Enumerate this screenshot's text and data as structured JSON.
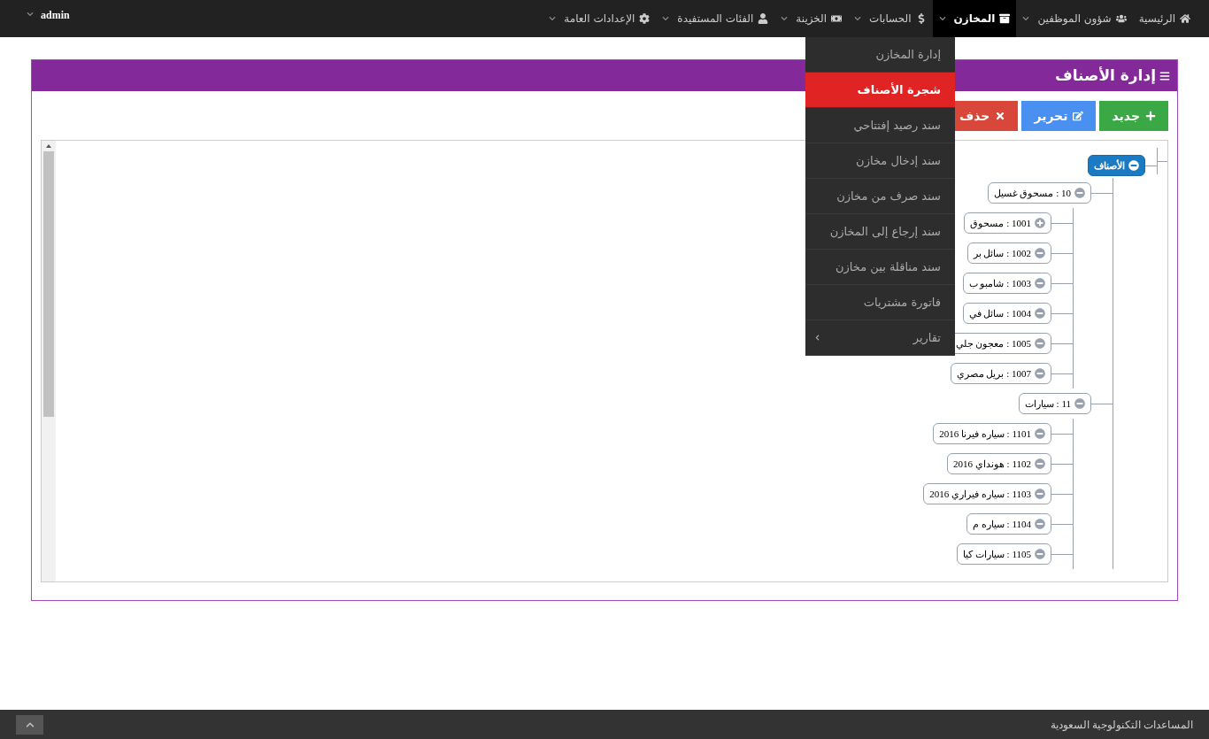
{
  "navbar": {
    "items": [
      {
        "label": "الرئيسية",
        "has_dropdown": false,
        "selected": false
      },
      {
        "label": "شؤون الموظفين",
        "has_dropdown": true,
        "selected": false
      },
      {
        "label": "المخازن",
        "has_dropdown": true,
        "selected": true
      },
      {
        "label": "الحسابات",
        "has_dropdown": true,
        "selected": false
      },
      {
        "label": "الخزينة",
        "has_dropdown": true,
        "selected": false
      },
      {
        "label": "الفئات المستفيدة",
        "has_dropdown": true,
        "selected": false
      },
      {
        "label": "الإعدادات العامة",
        "has_dropdown": true,
        "selected": false
      }
    ],
    "user": "admin"
  },
  "dropdown": {
    "items": [
      {
        "label": "إدارة المخازن",
        "selected": false,
        "has_submenu": false
      },
      {
        "label": "شجرة الأصناف",
        "selected": true,
        "has_submenu": false
      },
      {
        "label": "سند رصيد إفتتاحي",
        "selected": false,
        "has_submenu": false
      },
      {
        "label": "سند إدخال مخازن",
        "selected": false,
        "has_submenu": false
      },
      {
        "label": "سند صرف من مخازن",
        "selected": false,
        "has_submenu": false
      },
      {
        "label": "سند إرجاع إلى المخازن",
        "selected": false,
        "has_submenu": false
      },
      {
        "label": "سند مناقلة بين مخازن",
        "selected": false,
        "has_submenu": false
      },
      {
        "label": "فاتورة مشتريات",
        "selected": false,
        "has_submenu": false
      },
      {
        "label": "تقارير",
        "selected": false,
        "has_submenu": true
      }
    ]
  },
  "panel": {
    "title": "إدارة الأصناف",
    "buttons": [
      {
        "kind": "new",
        "label": "جديد"
      },
      {
        "kind": "edit",
        "label": "تحرير"
      },
      {
        "kind": "delete",
        "label": "حذف"
      }
    ],
    "tree": {
      "label": "الأصناف",
      "selected": true,
      "expanded": true,
      "children": [
        {
          "label": "10 : مسحوق غسيل",
          "selected": false,
          "expanded": true,
          "children": [
            {
              "label": "1001 : مسحوق",
              "selected": false,
              "expanded": false
            },
            {
              "label": "1002 : سائل بر",
              "selected": false,
              "expanded": true
            },
            {
              "label": "1003 : شامبو ب",
              "selected": false,
              "expanded": true
            },
            {
              "label": "1004 : سائل في",
              "selected": false,
              "expanded": true
            },
            {
              "label": "1005 : معجون جلي",
              "selected": false,
              "expanded": true
            },
            {
              "label": "1007 : بريل مصري",
              "selected": false,
              "expanded": true
            }
          ]
        },
        {
          "label": "11 : سيارات",
          "selected": false,
          "expanded": true,
          "children": [
            {
              "label": "1101 : سياره فيرنا 2016",
              "selected": false,
              "expanded": true
            },
            {
              "label": "1102 : هونداي 2016",
              "selected": false,
              "expanded": true
            },
            {
              "label": "1103 : سياره فيراري 2016",
              "selected": false,
              "expanded": true
            },
            {
              "label": "1104 : سياره م",
              "selected": false,
              "expanded": true
            },
            {
              "label": "1105 : سيارات كيا",
              "selected": false,
              "expanded": true
            }
          ]
        }
      ]
    }
  },
  "footer": {
    "text": "المساعدات التكنولوجية السعودية"
  }
}
